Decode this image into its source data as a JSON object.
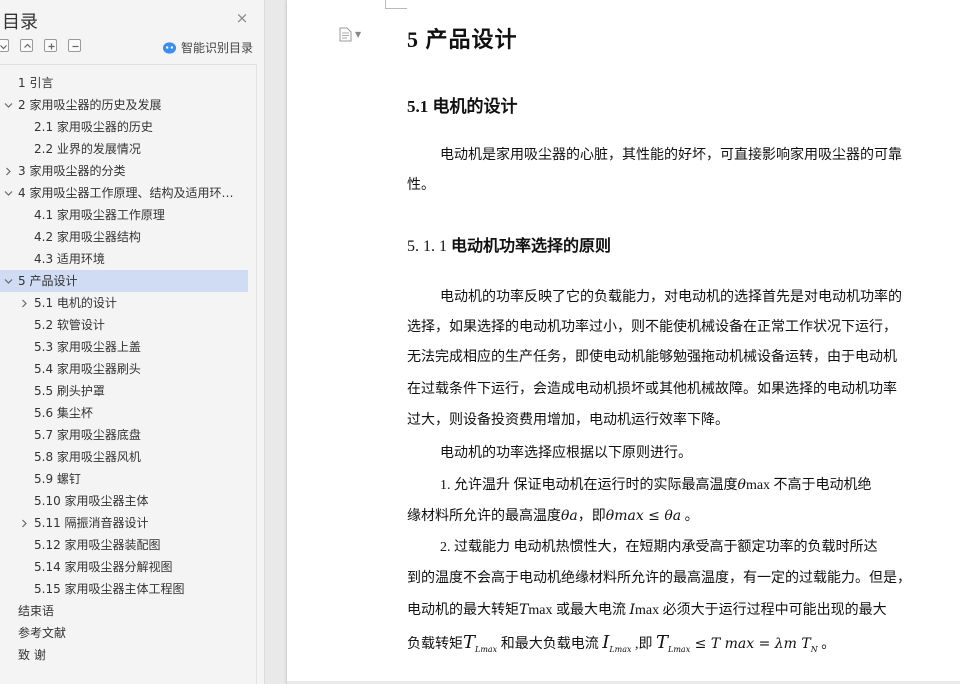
{
  "sidebar": {
    "title": "目录",
    "close_icon": "×",
    "tools": [
      "collapse-all-icon",
      "expand-up-icon",
      "expand-icon",
      "collapse-icon"
    ],
    "smart_toc_label": "智能识别目录",
    "items": [
      {
        "text": "1  引言",
        "level": 1,
        "arrow": "none"
      },
      {
        "text": "2  家用吸尘器的历史及发展",
        "level": 1,
        "arrow": "down"
      },
      {
        "text": "2.1  家用吸尘器的历史",
        "level": 2,
        "arrow": "none"
      },
      {
        "text": "2.2  业界的发展情况",
        "level": 2,
        "arrow": "none"
      },
      {
        "text": "3  家用吸尘器的分类",
        "level": 1,
        "arrow": "right"
      },
      {
        "text": "4  家用吸尘器工作原理、结构及适用环…",
        "level": 1,
        "arrow": "down"
      },
      {
        "text": "4.1  家用吸尘器工作原理",
        "level": 2,
        "arrow": "none"
      },
      {
        "text": "4.2  家用吸尘器结构",
        "level": 2,
        "arrow": "none"
      },
      {
        "text": "4.3  适用环境",
        "level": 2,
        "arrow": "none"
      },
      {
        "text": "5  产品设计",
        "level": 1,
        "arrow": "down",
        "active": true
      },
      {
        "text": "5.1 电机的设计",
        "level": 2,
        "arrow": "right"
      },
      {
        "text": "5.2 软管设计",
        "level": 2,
        "arrow": "none"
      },
      {
        "text": "5.3 家用吸尘器上盖",
        "level": 2,
        "arrow": "none"
      },
      {
        "text": "5.4 家用吸尘器刷头",
        "level": 2,
        "arrow": "none"
      },
      {
        "text": "5.5 刷头护罩",
        "level": 2,
        "arrow": "none"
      },
      {
        "text": "5.6 集尘杯",
        "level": 2,
        "arrow": "none"
      },
      {
        "text": "5.7 家用吸尘器底盘",
        "level": 2,
        "arrow": "none"
      },
      {
        "text": "5.8 家用吸尘器风机",
        "level": 2,
        "arrow": "none"
      },
      {
        "text": "5.9 螺钉",
        "level": 2,
        "arrow": "none"
      },
      {
        "text": "5.10 家用吸尘器主体",
        "level": 2,
        "arrow": "none"
      },
      {
        "text": "5.11 隔振消音器设计",
        "level": 2,
        "arrow": "right"
      },
      {
        "text": "5.12 家用吸尘器装配图",
        "level": 2,
        "arrow": "none"
      },
      {
        "text": "5.14 家用吸尘器分解视图",
        "level": 2,
        "arrow": "none"
      },
      {
        "text": "5.15 家用吸尘器主体工程图",
        "level": 2,
        "arrow": "none"
      },
      {
        "text": "结束语",
        "level": 0,
        "arrow": "none"
      },
      {
        "text": "参考文献",
        "level": 0,
        "arrow": "none"
      },
      {
        "text": "致    谢",
        "level": 0,
        "arrow": "none"
      }
    ]
  },
  "document": {
    "h1": "5  产品设计",
    "h2": "5.1 电机的设计",
    "p1_line1": "电动机是家用吸尘器的心脏，其性能的好坏，可直接影响家用吸尘器的可靠",
    "p1_line2": "性。",
    "h3_num": "5. 1. 1 ",
    "h3_text": "电动机功率选择的原则",
    "p2": [
      "电动机的功率反映了它的负载能力，对电动机的选择首先是对电动机功率的",
      "选择，如果选择的电动机功率过小，则不能使机械设备在正常工作状况下运行，",
      "无法完成相应的生产任务，即使电动机能够勉强拖动机械设备运转，由于电动机",
      "在过载条件下运行，会造成电动机损坏或其他机械故障。如果选择的电动机功率",
      "过大，则设备投资费用增加，电动机运行效率下降。"
    ],
    "p3": "电动机的功率选择应根据以下原则进行。",
    "p4_a": "1. 允许温升    保证电动机在运行时的实际最高温度",
    "p4_theta": "θ",
    "p4_max": "max",
    "p4_b": " 不高于电动机绝",
    "p4_line2_a": "缘材料所允许的最高温度",
    "p4_line2_theta_a": "θa",
    "p4_line2_b": "，即",
    "p4_line2_c": "θmax ≤ θa",
    "p4_line2_d": " 。",
    "p5": [
      "2.  过载能力    电动机热惯性大，在短期内承受高于额定功率的负载时所达",
      "到的温度不会高于电动机绝缘材料所允许的最高温度，有一定的过载能力。但是，",
      "电动机的最大转矩",
      "负载转矩"
    ],
    "p5_tmax": "T",
    "p5_tmax_sub": "max",
    "p5_mid": " 或最大电流 ",
    "p5_imax": "I",
    "p5_imax_sub": "max",
    "p5_end": " 必须大于运行过程中可能出现的最大",
    "p5_l4_t": "T",
    "p5_l4_tsub": "Lmax",
    "p5_l4_mid": " 和最大负载电流 ",
    "p5_l4_i": "I",
    "p5_l4_isub": "Lmax",
    "p5_l4_ji": " ,即 ",
    "p5_l4_t2": "T",
    "p5_l4_t2sub": "Lmax",
    "p5_l4_formula": " ≤ T max = λm T",
    "p5_l4_n": "N",
    "p5_l4_end": " 。"
  }
}
